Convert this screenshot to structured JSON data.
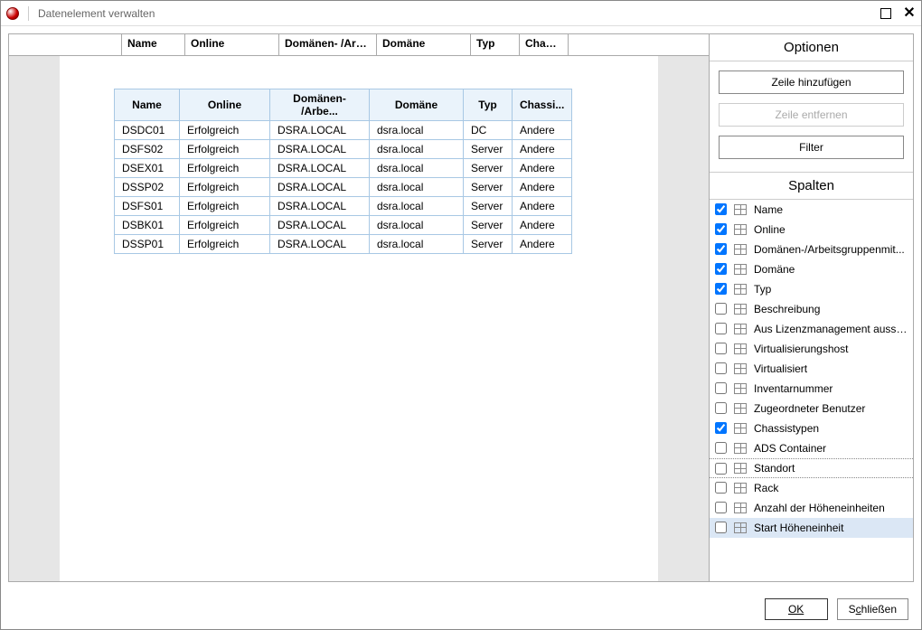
{
  "title": "Datenelement verwalten",
  "mainHeaders": {
    "name": "Name",
    "online": "Online",
    "dom": "Domänen- /Arbe...",
    "domain": "Domäne",
    "typ": "Typ",
    "chassis": "Chassi..."
  },
  "tableHeaders": {
    "name": "Name",
    "online": "Online",
    "dom": "Domänen- /Arbe...",
    "domain": "Domäne",
    "typ": "Typ",
    "chassis": "Chassi..."
  },
  "rows": [
    {
      "name": "DSDC01",
      "online": "Erfolgreich",
      "dom": "DSRA.LOCAL",
      "domain": "dsra.local",
      "typ": "DC",
      "chassis": "Andere"
    },
    {
      "name": "DSFS02",
      "online": "Erfolgreich",
      "dom": "DSRA.LOCAL",
      "domain": "dsra.local",
      "typ": "Server",
      "chassis": "Andere"
    },
    {
      "name": "DSEX01",
      "online": "Erfolgreich",
      "dom": "DSRA.LOCAL",
      "domain": "dsra.local",
      "typ": "Server",
      "chassis": "Andere"
    },
    {
      "name": "DSSP02",
      "online": "Erfolgreich",
      "dom": "DSRA.LOCAL",
      "domain": "dsra.local",
      "typ": "Server",
      "chassis": "Andere"
    },
    {
      "name": "DSFS01",
      "online": "Erfolgreich",
      "dom": "DSRA.LOCAL",
      "domain": "dsra.local",
      "typ": "Server",
      "chassis": "Andere"
    },
    {
      "name": "DSBK01",
      "online": "Erfolgreich",
      "dom": "DSRA.LOCAL",
      "domain": "dsra.local",
      "typ": "Server",
      "chassis": "Andere"
    },
    {
      "name": "DSSP01",
      "online": "Erfolgreich",
      "dom": "DSRA.LOCAL",
      "domain": "dsra.local",
      "typ": "Server",
      "chassis": "Andere"
    }
  ],
  "side": {
    "optionsHeader": "Optionen",
    "addRow": "Zeile hinzufügen",
    "removeRow": "Zeile entfernen",
    "filter": "Filter",
    "columnsHeader": "Spalten",
    "columns": [
      {
        "label": "Name",
        "checked": true
      },
      {
        "label": "Online",
        "checked": true
      },
      {
        "label": "Domänen-/Arbeitsgruppenmit...",
        "checked": true
      },
      {
        "label": "Domäne",
        "checked": true
      },
      {
        "label": "Typ",
        "checked": true
      },
      {
        "label": "Beschreibung",
        "checked": false
      },
      {
        "label": "Aus Lizenzmanagement aussch...",
        "checked": false
      },
      {
        "label": "Virtualisierungshost",
        "checked": false
      },
      {
        "label": "Virtualisiert",
        "checked": false
      },
      {
        "label": "Inventarnummer",
        "checked": false
      },
      {
        "label": "Zugeordneter Benutzer",
        "checked": false
      },
      {
        "label": "Chassistypen",
        "checked": true
      },
      {
        "label": "ADS Container",
        "checked": false
      },
      {
        "label": "Standort",
        "checked": false,
        "dotted": true
      },
      {
        "label": "Rack",
        "checked": false
      },
      {
        "label": "Anzahl der Höheneinheiten",
        "checked": false
      },
      {
        "label": "Start Höheneinheit",
        "checked": false,
        "selected": true
      }
    ]
  },
  "footer": {
    "ok": "OK",
    "close": "Schließen"
  }
}
